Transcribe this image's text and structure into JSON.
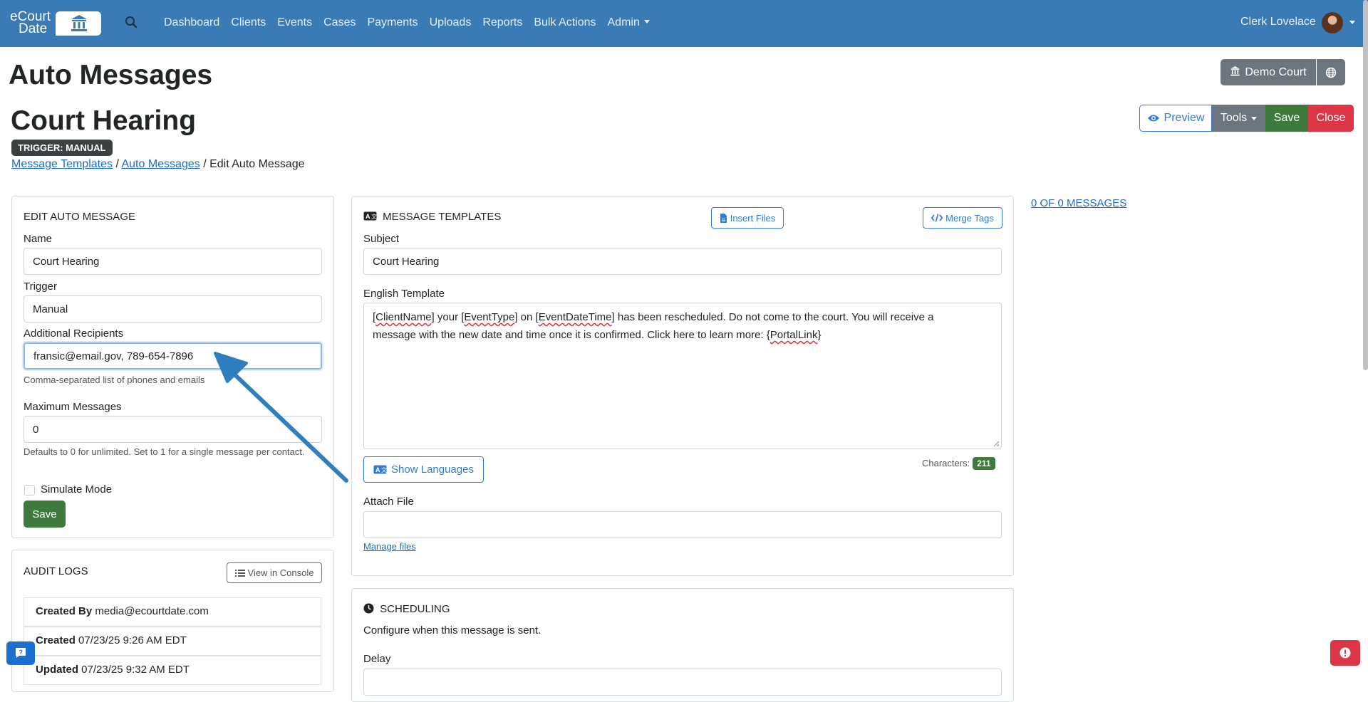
{
  "colors": {
    "navbar": "#3a7ab5",
    "primary": "#2f7bd6",
    "success": "#3e7a3e",
    "danger": "#dc3545",
    "secondary": "#6c757d",
    "annotation_arrow": "#2f7fc0"
  },
  "navbar": {
    "logo_line1": "eCourt",
    "logo_line2": "Date",
    "logo_icon": "courthouse-icon",
    "search_icon": "search-icon",
    "links": [
      "Dashboard",
      "Clients",
      "Events",
      "Cases",
      "Payments",
      "Uploads",
      "Reports",
      "Bulk Actions"
    ],
    "admin_label": "Admin",
    "user_name": "Clerk Lovelace"
  },
  "page": {
    "heading": "Auto Messages",
    "message_title": "Court Hearing",
    "trigger_badge": "TRIGGER: MANUAL",
    "breadcrumb": {
      "link1": "Message Templates",
      "sep": "/",
      "link2": "Auto Messages",
      "current": "Edit Auto Message"
    }
  },
  "toolbar": {
    "court_label": "Demo Court",
    "preview_label": "Preview",
    "tools_label": "Tools",
    "save_label": "Save",
    "close_label": "Close"
  },
  "edit_form": {
    "title": "EDIT AUTO MESSAGE",
    "name_label": "Name",
    "name_value": "Court Hearing",
    "trigger_label": "Trigger",
    "trigger_value": "Manual",
    "recipients_label": "Additional Recipients",
    "recipients_value": "fransic@email.gov, 789-654-7896",
    "recipients_help": "Comma-separated list of phones and emails",
    "max_label": "Maximum Messages",
    "max_value": "0",
    "max_help": "Defaults to 0 for unlimited. Set to 1 for a single message per contact.",
    "simulate_label": "Simulate Mode",
    "save_label": "Save"
  },
  "audit": {
    "title": "AUDIT LOGS",
    "console_label": "View in Console",
    "rows": [
      {
        "key": "Created By",
        "value": "media@ecourtdate.com"
      },
      {
        "key": "Created",
        "value": "07/23/25 9:26 AM EDT"
      },
      {
        "key": "Updated",
        "value": "07/23/25 9:32 AM EDT"
      }
    ]
  },
  "templates": {
    "title": "MESSAGE TEMPLATES",
    "insert_files_label": "Insert Files",
    "merge_tags_label": "Merge Tags",
    "subject_label": "Subject",
    "subject_value": "Court Hearing",
    "english_label": "English Template",
    "body": {
      "t1": "ClientName",
      "t2": "EventType",
      "t3": "EventDateTime",
      "line1_rest": "has been rescheduled. Do not come to the court. You will receive a",
      "line2": "message with the new date and time once it is confirmed. Click here to learn more: {",
      "t4": "PortalLink",
      "your": "your",
      "on": "on"
    },
    "show_languages_label": "Show Languages",
    "characters_label": "Characters:",
    "characters_count": "211",
    "attach_label": "Attach File",
    "manage_files_label": "Manage files"
  },
  "scheduling": {
    "title": "SCHEDULING",
    "description": "Configure when this message is sent.",
    "delay_label": "Delay"
  },
  "messages_link": "0 OF 0 MESSAGES"
}
